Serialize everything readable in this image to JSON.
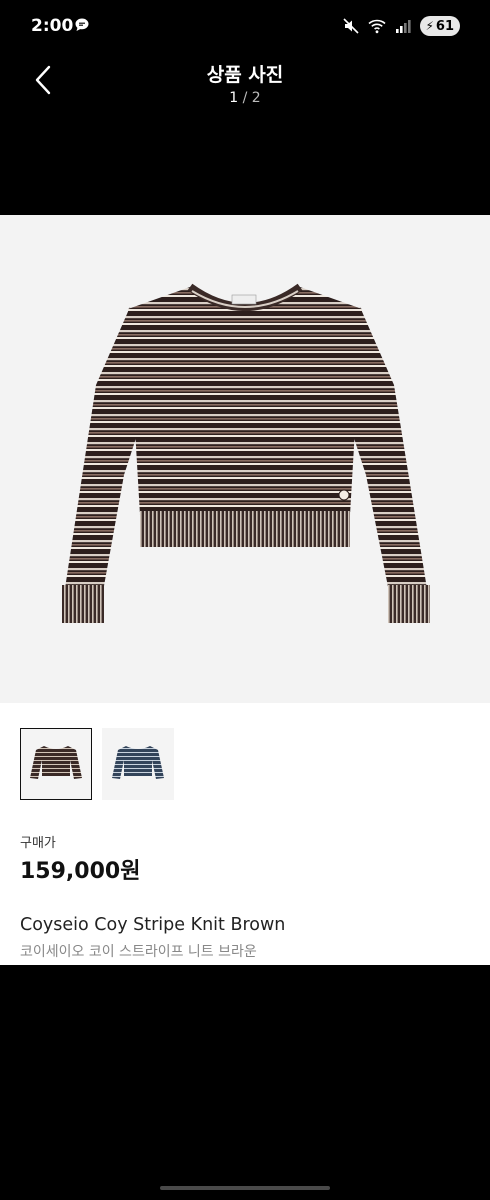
{
  "status_bar": {
    "time": "2:00",
    "battery": "61",
    "icons": [
      "chat-notification-icon",
      "mute-icon",
      "wifi-icon",
      "signal-icon",
      "battery-icon"
    ]
  },
  "header": {
    "title": "상품 사진",
    "counter_current": "1",
    "counter_total": "/ 2",
    "back_icon": "chevron-left-icon"
  },
  "product": {
    "image_desc": "brown stripe knit sweater",
    "thumbnails": [
      {
        "label": "brown-stripe-knit",
        "selected": true,
        "color": "#4a3632"
      },
      {
        "label": "blue-stripe-knit",
        "selected": false,
        "color": "#3c4f66"
      }
    ],
    "price_label": "구매가",
    "price": "159,000원",
    "name_en": "Coyseio Coy Stripe Knit Brown",
    "name_ko": "코이세이오 코이 스트라이프 니트 브라운"
  },
  "colors": {
    "background": "#000000",
    "panel": "#ffffff",
    "photo_bg": "#f3f3f3"
  }
}
